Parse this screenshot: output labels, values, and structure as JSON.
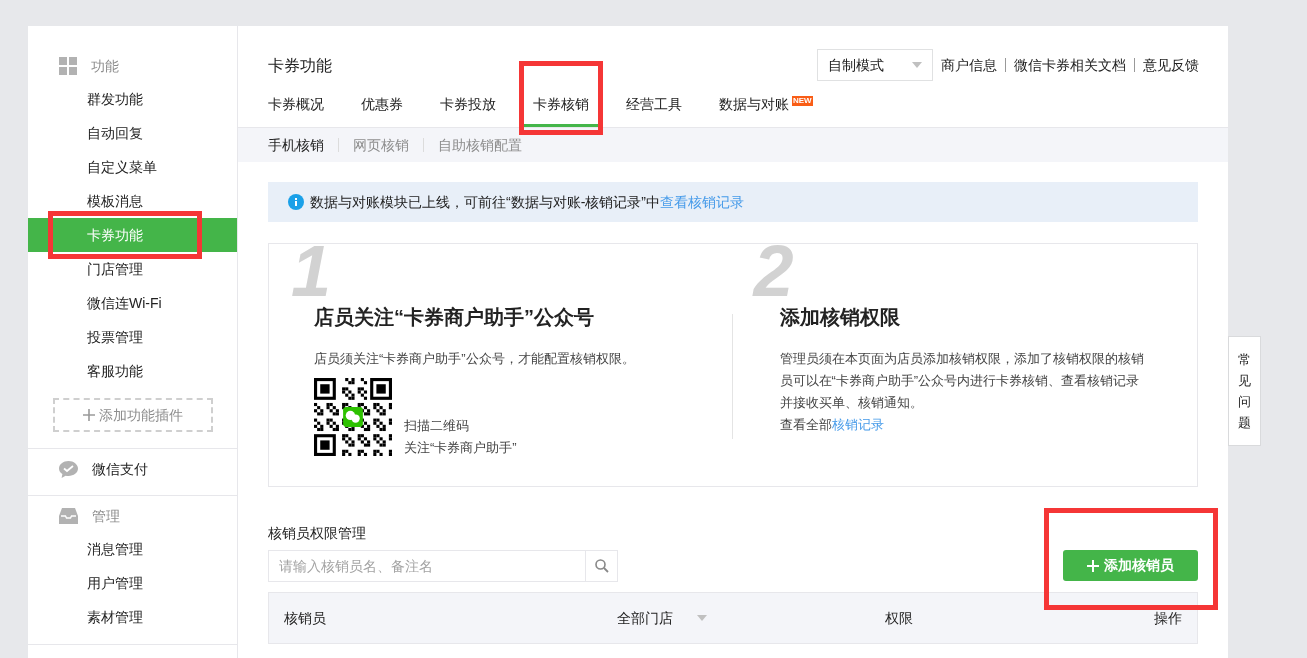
{
  "sidebar": {
    "sections": [
      {
        "kind": "grid",
        "title": "功能",
        "items": [
          {
            "label": "群发功能",
            "selected": false,
            "highlighted": false
          },
          {
            "label": "自动回复",
            "selected": false,
            "highlighted": false
          },
          {
            "label": "自定义菜单",
            "selected": false,
            "highlighted": false
          },
          {
            "label": "模板消息",
            "selected": false,
            "highlighted": false
          },
          {
            "label": "卡券功能",
            "selected": true,
            "highlighted": true
          },
          {
            "label": "门店管理",
            "selected": false,
            "highlighted": false
          },
          {
            "label": "微信连Wi-Fi",
            "selected": false,
            "highlighted": false
          },
          {
            "label": "投票管理",
            "selected": false,
            "highlighted": false
          },
          {
            "label": "客服功能",
            "selected": false,
            "highlighted": false
          }
        ],
        "add_button": "添加功能插件"
      },
      {
        "kind": "pay",
        "title": "微信支付"
      },
      {
        "kind": "tray",
        "title": "管理",
        "items": [
          {
            "label": "消息管理",
            "selected": false,
            "highlighted": false
          },
          {
            "label": "用户管理",
            "selected": false,
            "highlighted": false
          },
          {
            "label": "素材管理",
            "selected": false,
            "highlighted": false
          }
        ]
      }
    ]
  },
  "header": {
    "title": "卡券功能",
    "mode_select": "自制模式",
    "links": [
      "商户信息",
      "微信卡券相关文档",
      "意见反馈"
    ]
  },
  "tabs": [
    {
      "label": "卡券概况",
      "selected": false,
      "highlighted": false
    },
    {
      "label": "优惠券",
      "selected": false,
      "highlighted": false
    },
    {
      "label": "卡券投放",
      "selected": false,
      "highlighted": false
    },
    {
      "label": "卡券核销",
      "selected": true,
      "highlighted": true
    },
    {
      "label": "经营工具",
      "selected": false,
      "highlighted": false
    },
    {
      "label": "数据与对账",
      "selected": false,
      "highlighted": false,
      "badge": "NEW"
    }
  ],
  "subtabs": [
    {
      "label": "手机核销",
      "selected": true
    },
    {
      "label": "网页核销",
      "selected": false
    },
    {
      "label": "自助核销配置",
      "selected": false
    }
  ],
  "notice": {
    "text": "数据与对账模块已上线，可前往“数据与对账-核销记录”中",
    "link": "查看核销记录"
  },
  "steps": [
    {
      "number": "1",
      "title": "店员关注“卡券商户助手”公众号",
      "description": "店员须关注“卡券商户助手”公众号，才能配置核销权限。",
      "qr_caption": [
        "扫描二维码",
        "关注“卡券商户助手”"
      ]
    },
    {
      "number": "2",
      "title": "添加核销权限",
      "description": "管理员须在本页面为店员添加核销权限，添加了核销权限的核销员可以在“卡券商户助手”公众号内进行卡券核销、查看核销记录并接收买单、核销通知。",
      "link_prefix": "查看全部",
      "link": "核销记录"
    }
  ],
  "staff": {
    "title": "核销员权限管理",
    "search": {
      "placeholder": "请输入核销员名、备注名"
    },
    "add_button": {
      "label": "添加核销员",
      "highlighted": true
    },
    "columns": [
      "核销员",
      "全部门店",
      "权限",
      "操作"
    ]
  },
  "side_tab": "常见问题"
}
